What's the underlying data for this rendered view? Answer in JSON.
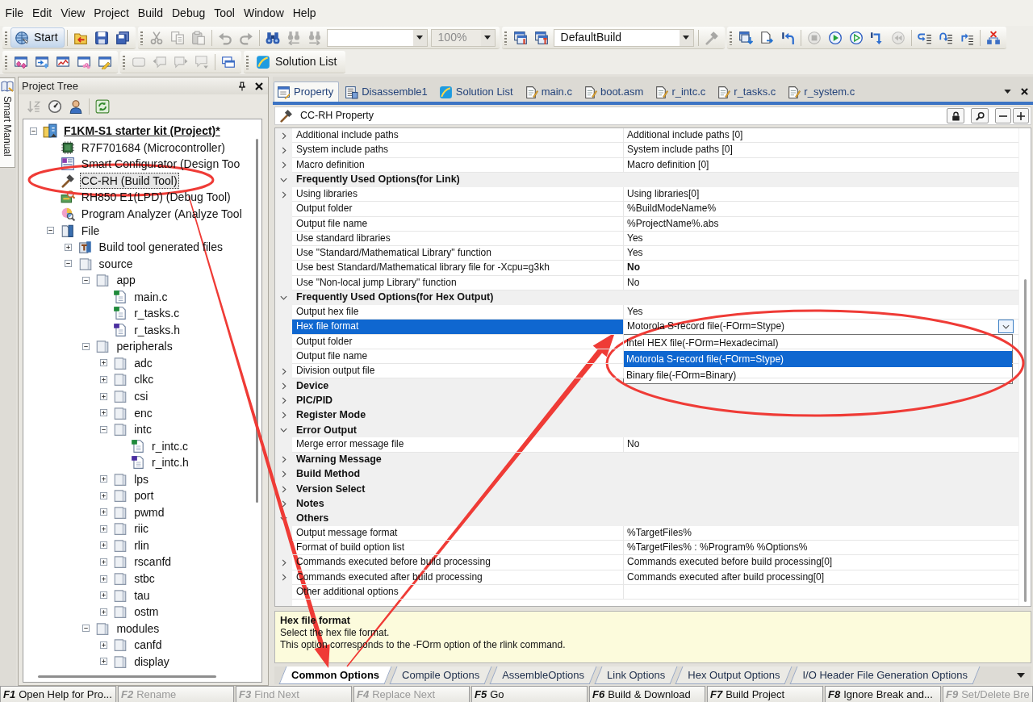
{
  "menu": [
    "File",
    "Edit",
    "View",
    "Project",
    "Build",
    "Debug",
    "Tool",
    "Window",
    "Help"
  ],
  "toolbars": [
    [
      [
        [
          {
            "kind": "button",
            "label": "Start",
            "pressed": true,
            "disabled": false
          }
        ],
        [
          {
            "kind": "icon",
            "disabled": false
          },
          {
            "kind": "icon",
            "disabled": false
          },
          {
            "kind": "icon",
            "disabled": false
          }
        ]
      ],
      [
        [
          {
            "kind": "icon",
            "disabled": true
          },
          {
            "kind": "icon",
            "disabled": true
          },
          {
            "kind": "icon",
            "disabled": true
          }
        ],
        [
          {
            "kind": "icon",
            "disabled": true
          },
          {
            "kind": "icon",
            "disabled": true
          }
        ],
        [
          {
            "kind": "icon",
            "disabled": false
          },
          {
            "kind": "icon",
            "disabled": true
          },
          {
            "kind": "icon",
            "disabled": true
          },
          {
            "kind": "combo",
            "disabled": false
          },
          {
            "kind": "combo",
            "value": "100%",
            "disabled": true
          }
        ]
      ],
      [
        [
          {
            "kind": "icon",
            "disabled": false
          },
          {
            "kind": "icon",
            "disabled": false
          },
          {
            "kind": "combo",
            "value": "DefaultBuild",
            "disabled": false
          }
        ],
        [
          {
            "kind": "icon",
            "disabled": true
          }
        ]
      ],
      [
        [
          {
            "kind": "icon",
            "disabled": false
          },
          {
            "kind": "icon",
            "disabled": false
          },
          {
            "kind": "icon",
            "disabled": false
          }
        ],
        [
          {
            "kind": "icon",
            "disabled": true
          },
          {
            "kind": "icon",
            "disabled": false
          },
          {
            "kind": "icon",
            "disabled": false
          },
          {
            "kind": "icon",
            "disabled": false
          },
          {
            "kind": "icon",
            "disabled": true
          }
        ],
        [
          {
            "kind": "icon",
            "disabled": false
          },
          {
            "kind": "icon",
            "disabled": false
          },
          {
            "kind": "icon",
            "disabled": false
          }
        ],
        [
          {
            "kind": "icon",
            "disabled": false
          }
        ]
      ]
    ],
    [
      [
        [
          {
            "kind": "icon",
            "disabled": false
          },
          {
            "kind": "icon",
            "disabled": false
          },
          {
            "kind": "icon",
            "disabled": false
          },
          {
            "kind": "icon",
            "disabled": false
          },
          {
            "kind": "icon",
            "disabled": false
          }
        ]
      ],
      [
        [
          {
            "kind": "icon",
            "disabled": true
          },
          {
            "kind": "icon",
            "disabled": true
          },
          {
            "kind": "icon",
            "disabled": true
          },
          {
            "kind": "icon",
            "disabled": true
          }
        ],
        [
          {
            "kind": "icon",
            "disabled": false
          }
        ]
      ],
      [
        [
          {
            "kind": "button",
            "label": "Solution List",
            "pressed": false,
            "disabled": false
          }
        ]
      ]
    ]
  ],
  "smart_manual_tab": {
    "label": "Smart Manual"
  },
  "project_tree": {
    "title": "Project Tree",
    "toolbar": [
      {
        "disabled": true
      },
      {
        "disabled": false
      },
      {
        "disabled": false
      },
      {
        "disabled": false
      }
    ],
    "nodes": [
      {
        "label": "F1KM-S1 starter kit (Project)*",
        "kind": "project",
        "expanded": true,
        "selected": false,
        "children": [
          {
            "label": "R7F701684 (Microcontroller)",
            "kind": "microcontroller",
            "selected": false
          },
          {
            "label": "Smart Configurator (Design Too",
            "kind": "design_tool",
            "selected": false
          },
          {
            "label": "CC-RH (Build Tool)",
            "kind": "build_tool",
            "selected": true
          },
          {
            "label": "RH850 E1(LPD) (Debug Tool)",
            "kind": "debug_tool",
            "selected": false
          },
          {
            "label": "Program Analyzer (Analyze Tool",
            "kind": "analyze_tool",
            "selected": false
          },
          {
            "label": "File",
            "kind": "file_category",
            "expanded": true,
            "selected": false,
            "children": [
              {
                "label": "Build tool generated files",
                "kind": "build_files",
                "expanded": false,
                "selected": false
              },
              {
                "label": "source",
                "kind": "folder",
                "expanded": true,
                "selected": false,
                "children": [
                  {
                    "label": "app",
                    "kind": "folder",
                    "expanded": true,
                    "selected": false,
                    "children": [
                      {
                        "label": "main.c",
                        "kind": "c_file",
                        "selected": false
                      },
                      {
                        "label": "r_tasks.c",
                        "kind": "c_file",
                        "selected": false
                      },
                      {
                        "label": "r_tasks.h",
                        "kind": "h_file",
                        "selected": false
                      }
                    ]
                  },
                  {
                    "label": "peripherals",
                    "kind": "folder",
                    "expanded": true,
                    "selected": false,
                    "children": [
                      {
                        "label": "adc",
                        "kind": "folder",
                        "expanded": false,
                        "selected": false
                      },
                      {
                        "label": "clkc",
                        "kind": "folder",
                        "expanded": false,
                        "selected": false
                      },
                      {
                        "label": "csi",
                        "kind": "folder",
                        "expanded": false,
                        "selected": false
                      },
                      {
                        "label": "enc",
                        "kind": "folder",
                        "expanded": false,
                        "selected": false
                      },
                      {
                        "label": "intc",
                        "kind": "folder",
                        "expanded": true,
                        "selected": false,
                        "children": [
                          {
                            "label": "r_intc.c",
                            "kind": "c_file",
                            "selected": false
                          },
                          {
                            "label": "r_intc.h",
                            "kind": "h_file",
                            "selected": false
                          }
                        ]
                      },
                      {
                        "label": "lps",
                        "kind": "folder",
                        "expanded": false,
                        "selected": false
                      },
                      {
                        "label": "port",
                        "kind": "folder",
                        "expanded": false,
                        "selected": false
                      },
                      {
                        "label": "pwmd",
                        "kind": "folder",
                        "expanded": false,
                        "selected": false
                      },
                      {
                        "label": "riic",
                        "kind": "folder",
                        "expanded": false,
                        "selected": false
                      },
                      {
                        "label": "rlin",
                        "kind": "folder",
                        "expanded": false,
                        "selected": false
                      },
                      {
                        "label": "rscanfd",
                        "kind": "folder",
                        "expanded": false,
                        "selected": false
                      },
                      {
                        "label": "stbc",
                        "kind": "folder",
                        "expanded": false,
                        "selected": false
                      },
                      {
                        "label": "tau",
                        "kind": "folder",
                        "expanded": false,
                        "selected": false
                      },
                      {
                        "label": "ostm",
                        "kind": "folder",
                        "expanded": false,
                        "selected": false
                      }
                    ]
                  },
                  {
                    "label": "modules",
                    "kind": "folder",
                    "expanded": true,
                    "selected": false,
                    "children": [
                      {
                        "label": "canfd",
                        "kind": "folder",
                        "expanded": false,
                        "selected": false
                      },
                      {
                        "label": "display",
                        "kind": "folder",
                        "expanded": false,
                        "selected": false
                      }
                    ]
                  }
                ]
              }
            ]
          }
        ]
      }
    ]
  },
  "document_tabs": [
    {
      "label": "Property",
      "kind": "property",
      "selected": true
    },
    {
      "label": "Disassemble1",
      "kind": "disassemble",
      "selected": false
    },
    {
      "label": "Solution List",
      "kind": "solution",
      "selected": false
    },
    {
      "label": "main.c",
      "kind": "file",
      "selected": false
    },
    {
      "label": "boot.asm",
      "kind": "file",
      "selected": false
    },
    {
      "label": "r_intc.c",
      "kind": "file",
      "selected": false
    },
    {
      "label": "r_tasks.c",
      "kind": "file",
      "selected": false
    },
    {
      "label": "r_system.c",
      "kind": "file",
      "selected": false
    }
  ],
  "property_panel": {
    "title": "CC-RH Property",
    "rows": [
      {
        "kind": "property",
        "name": "Additional include paths",
        "value": "Additional include paths [0]",
        "expanded": false,
        "selected": false,
        "modified": false
      },
      {
        "kind": "property",
        "name": "System include paths",
        "value": "System include paths [0]",
        "expanded": false,
        "selected": false,
        "modified": false
      },
      {
        "kind": "property",
        "name": "Macro definition",
        "value": "Macro definition [0]",
        "expanded": false,
        "selected": false,
        "modified": false
      },
      {
        "kind": "category",
        "name": "Frequently Used Options(for Link)",
        "expanded": true,
        "selected": false
      },
      {
        "kind": "property",
        "name": "Using libraries",
        "value": "Using libraries[0]",
        "expanded": false,
        "selected": false,
        "modified": false
      },
      {
        "kind": "property",
        "name": "Output folder",
        "value": "%BuildModeName%",
        "selected": false,
        "modified": false
      },
      {
        "kind": "property",
        "name": "Output file name",
        "value": "%ProjectName%.abs",
        "selected": false,
        "modified": false
      },
      {
        "kind": "property",
        "name": "Use standard libraries",
        "value": "Yes",
        "selected": false,
        "modified": false
      },
      {
        "kind": "property",
        "name": "Use \"Standard/Mathematical Library\" function",
        "value": "Yes",
        "selected": false,
        "modified": false
      },
      {
        "kind": "property",
        "name": "Use best Standard/Mathematical library file for -Xcpu=g3kh",
        "value": "No",
        "selected": false,
        "modified": true
      },
      {
        "kind": "property",
        "name": "Use \"Non-local jump Library\" function",
        "value": "No",
        "selected": false,
        "modified": false
      },
      {
        "kind": "category",
        "name": "Frequently Used Options(for Hex Output)",
        "expanded": true,
        "selected": false
      },
      {
        "kind": "property",
        "name": "Output hex file",
        "value": "Yes",
        "selected": false,
        "modified": false
      },
      {
        "kind": "property",
        "name": "Hex file format",
        "value": "Motorola S-record file(-FOrm=Stype)",
        "selected": true,
        "modified": false,
        "options": [
          {
            "label": "Intel HEX file(-FOrm=Hexadecimal)",
            "selected": false
          },
          {
            "label": "Motorola S-record file(-FOrm=Stype)",
            "selected": true
          },
          {
            "label": "Binary file(-FOrm=Binary)",
            "selected": false
          }
        ]
      },
      {
        "kind": "property",
        "name": "Output folder",
        "selected": false
      },
      {
        "kind": "property",
        "name": "Output file name",
        "selected": false
      },
      {
        "kind": "property",
        "name": "Division output file",
        "expanded": false,
        "selected": false
      },
      {
        "kind": "category",
        "name": "Device",
        "expanded": false,
        "selected": false
      },
      {
        "kind": "category",
        "name": "PIC/PID",
        "expanded": false,
        "selected": false
      },
      {
        "kind": "category",
        "name": "Register Mode",
        "expanded": false,
        "selected": false
      },
      {
        "kind": "category",
        "name": "Error Output",
        "expanded": true,
        "selected": false
      },
      {
        "kind": "property",
        "name": "Merge error message file",
        "value": "No",
        "selected": false,
        "modified": false
      },
      {
        "kind": "category",
        "name": "Warning Message",
        "expanded": false,
        "selected": false
      },
      {
        "kind": "category",
        "name": "Build Method",
        "expanded": false,
        "selected": false
      },
      {
        "kind": "category",
        "name": "Version Select",
        "expanded": false,
        "selected": false
      },
      {
        "kind": "category",
        "name": "Notes",
        "expanded": false,
        "selected": false
      },
      {
        "kind": "category",
        "name": "Others",
        "expanded": true,
        "selected": false
      },
      {
        "kind": "property",
        "name": "Output message format",
        "value": "%TargetFiles%",
        "selected": false,
        "modified": false
      },
      {
        "kind": "property",
        "name": "Format of build option list",
        "value": "%TargetFiles% : %Program% %Options%",
        "selected": false,
        "modified": false
      },
      {
        "kind": "property",
        "name": "Commands executed before build processing",
        "value": "Commands executed before build processing[0]",
        "expanded": false,
        "selected": false,
        "modified": false
      },
      {
        "kind": "property",
        "name": "Commands executed after build processing",
        "value": "Commands executed after build processing[0]",
        "expanded": false,
        "selected": false,
        "modified": false
      },
      {
        "kind": "property",
        "name": "Other additional options",
        "selected": false
      }
    ]
  },
  "help": {
    "title": "Hex file format",
    "lines": [
      "Select the hex file format.",
      "This option corresponds to the -FOrm option of the rlink command."
    ]
  },
  "option_tabs": [
    {
      "label": "Common Options",
      "selected": true
    },
    {
      "label": "Compile Options",
      "selected": false
    },
    {
      "label": "AssembleOptions",
      "selected": false
    },
    {
      "label": "Link Options",
      "selected": false
    },
    {
      "label": "Hex Output Options",
      "selected": false
    },
    {
      "label": "I/O Header File Generation Options",
      "selected": false
    }
  ],
  "function_keys": [
    {
      "key": "F1",
      "label": "Open Help for Pro...",
      "disabled": false
    },
    {
      "key": "F2",
      "label": "Rename",
      "disabled": true
    },
    {
      "key": "F3",
      "label": "Find Next",
      "disabled": true
    },
    {
      "key": "F4",
      "label": "Replace Next",
      "disabled": true
    },
    {
      "key": "F5",
      "label": "Go",
      "disabled": false
    },
    {
      "key": "F6",
      "label": "Build & Download",
      "disabled": false
    },
    {
      "key": "F7",
      "label": "Build Project",
      "disabled": false
    },
    {
      "key": "F8",
      "label": "Ignore Break and...",
      "disabled": false
    },
    {
      "key": "F9",
      "label": "Set/Delete Bre",
      "disabled": true
    }
  ],
  "annotations": [
    {
      "kind": "ellipse"
    },
    {
      "kind": "ellipse"
    },
    {
      "kind": "arrow"
    },
    {
      "kind": "arrow"
    }
  ]
}
